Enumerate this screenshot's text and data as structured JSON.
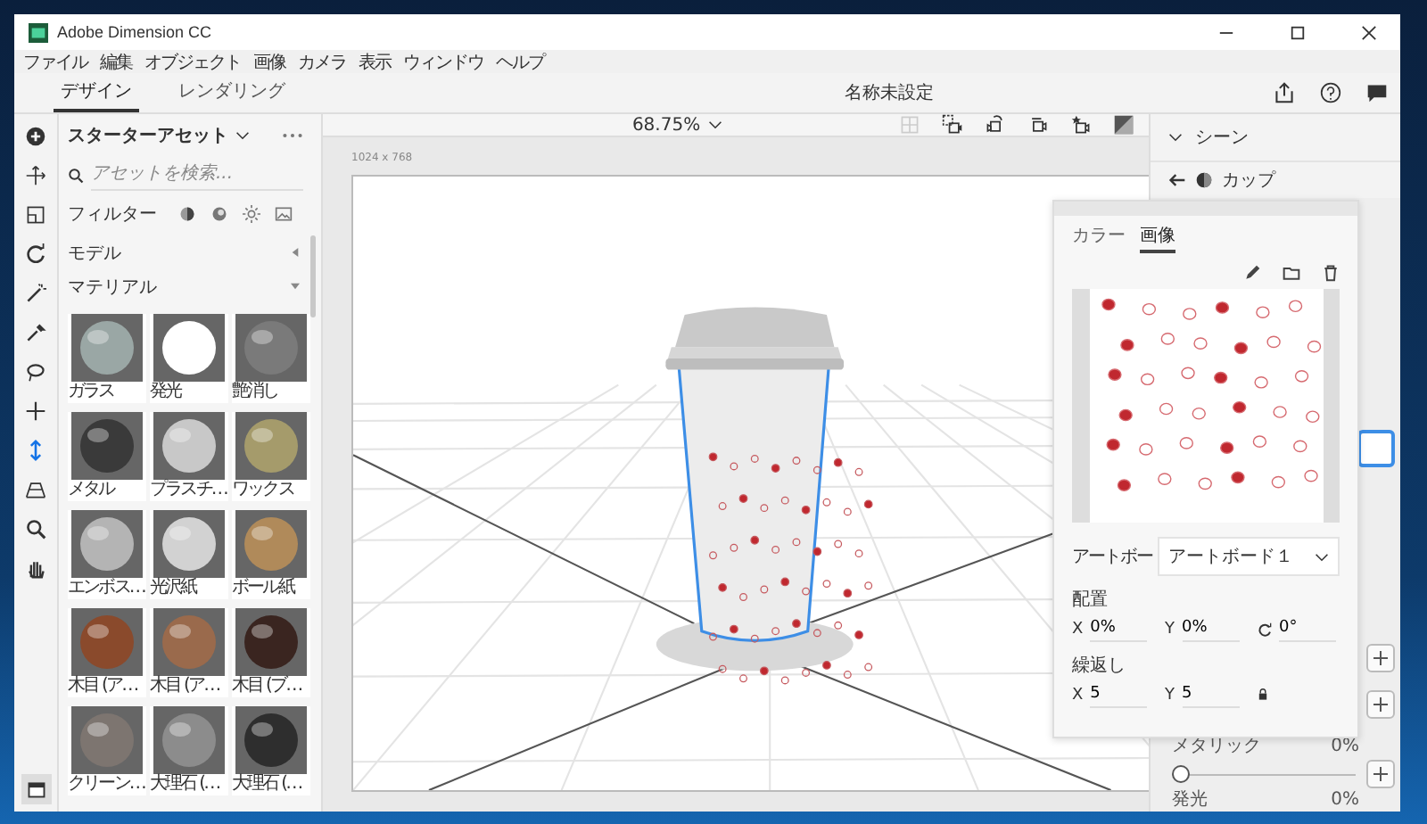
{
  "window": {
    "title": "Adobe Dimension CC"
  },
  "menu": [
    "ファイル",
    "編集",
    "オブジェクト",
    "画像",
    "カメラ",
    "表示",
    "ウィンドウ",
    "ヘルプ"
  ],
  "mode_tabs": [
    {
      "label": "デザイン",
      "selected": true
    },
    {
      "label": "レンダリング",
      "selected": false
    }
  ],
  "document_title": "名称未設定",
  "tools": [
    {
      "kind": "add",
      "selected": false
    },
    {
      "kind": "move",
      "selected": false
    },
    {
      "kind": "frame",
      "selected": false
    },
    {
      "kind": "rotate",
      "selected": false
    },
    {
      "kind": "wand",
      "selected": false
    },
    {
      "kind": "dropper",
      "selected": false
    },
    {
      "kind": "lasso",
      "selected": false
    },
    {
      "kind": "plus",
      "selected": false
    },
    {
      "kind": "vertical",
      "selected": true
    },
    {
      "kind": "perspective",
      "selected": false
    },
    {
      "kind": "zoom",
      "selected": false
    },
    {
      "kind": "hand",
      "selected": false
    }
  ],
  "assets": {
    "title": "スターターアセット",
    "search": {
      "placeholder": "アセットを検索..."
    },
    "filter_label": "フィルター",
    "sections": [
      {
        "label": "モデル",
        "expanded": false
      },
      {
        "label": "マテリアル",
        "expanded": true
      }
    ],
    "materials": [
      {
        "label": "ガラス",
        "color": "#9aa7a5"
      },
      {
        "label": "発光",
        "color": "#ffffff"
      },
      {
        "label": "艶消し",
        "color": "#7a7a7a"
      },
      {
        "label": "メタル",
        "color": "#3a3a3a"
      },
      {
        "label": "プラスチ…",
        "color": "#c8c8c8"
      },
      {
        "label": "ワックス",
        "color": "#a59b6b"
      },
      {
        "label": "エンボス…",
        "color": "#b4b4b4"
      },
      {
        "label": "光沢紙",
        "color": "#d2d2d2"
      },
      {
        "label": "ボール紙",
        "color": "#b08a5a"
      },
      {
        "label": "木目 (ア…",
        "color": "#8a4a2c"
      },
      {
        "label": "木目 (ア…",
        "color": "#9a6a4c"
      },
      {
        "label": "木目 (ブ…",
        "color": "#3a2520"
      },
      {
        "label": "クリーン…",
        "color": "#7d7570"
      },
      {
        "label": "大理石 (…",
        "color": "#8c8c8c"
      },
      {
        "label": "大理石 (…",
        "color": "#2e2e2e"
      }
    ]
  },
  "canvas": {
    "zoom": "68.75%",
    "size_label": "1024 x 768"
  },
  "scene": {
    "title": "シーン",
    "object": "カップ",
    "properties": [
      {
        "label": "メタリック",
        "reading": "0%",
        "level": 0.0
      },
      {
        "label": "発光",
        "reading": "0%"
      }
    ]
  },
  "image_popup": {
    "tabs": [
      {
        "label": "カラー",
        "selected": false
      },
      {
        "label": "画像",
        "selected": true
      }
    ],
    "artboard_label": "アートボー",
    "artboard_value": "アートボード１",
    "placement_label": "配置",
    "placement_fields": [
      {
        "kind": "axis",
        "label": "X",
        "value": "0%"
      },
      {
        "kind": "axis",
        "label": "Y",
        "value": "0%"
      },
      {
        "kind": "rotation",
        "value": "0°"
      }
    ],
    "repeat_label": "繰返し",
    "repeat_fields": [
      {
        "kind": "axis",
        "label": "X",
        "value": "5"
      },
      {
        "kind": "axis",
        "label": "Y",
        "value": "5"
      }
    ]
  }
}
